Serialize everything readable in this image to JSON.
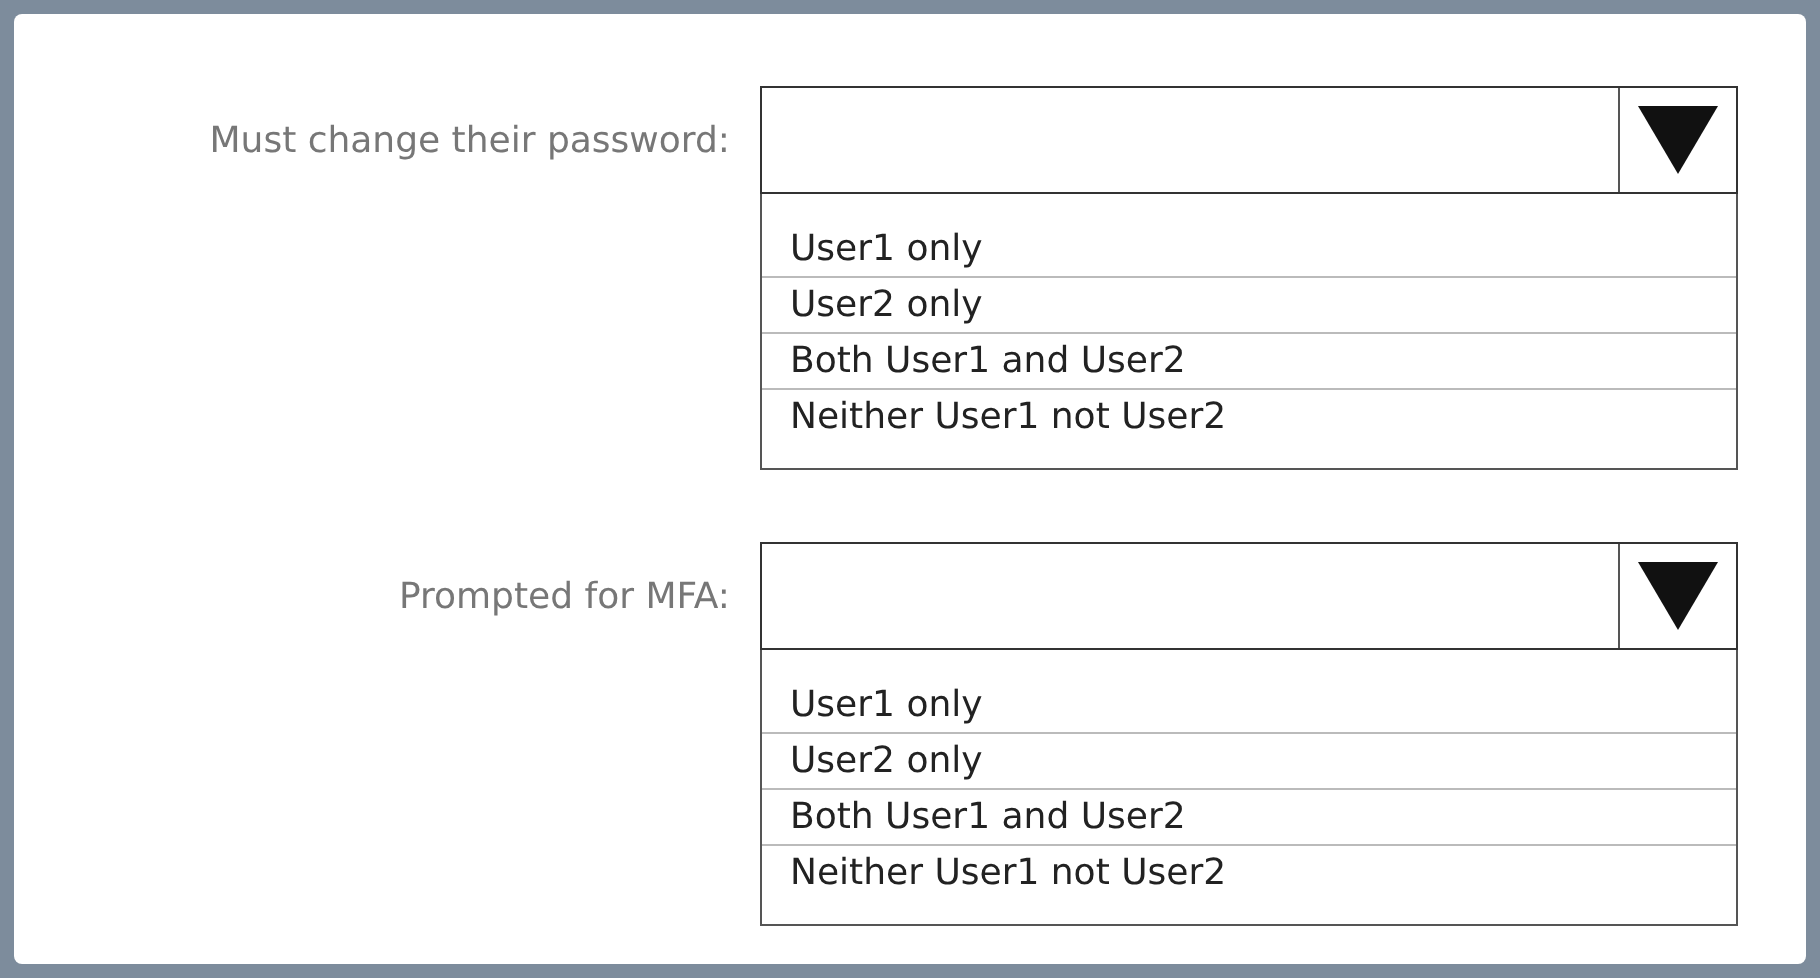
{
  "questions": [
    {
      "label": "Must change their password:",
      "options": [
        "User1 only",
        "User2 only",
        "Both User1 and User2",
        "Neither User1 not User2"
      ]
    },
    {
      "label": "Prompted for MFA:",
      "options": [
        "User1 only",
        "User2 only",
        "Both User1 and User2",
        "Neither User1 not User2"
      ]
    }
  ]
}
